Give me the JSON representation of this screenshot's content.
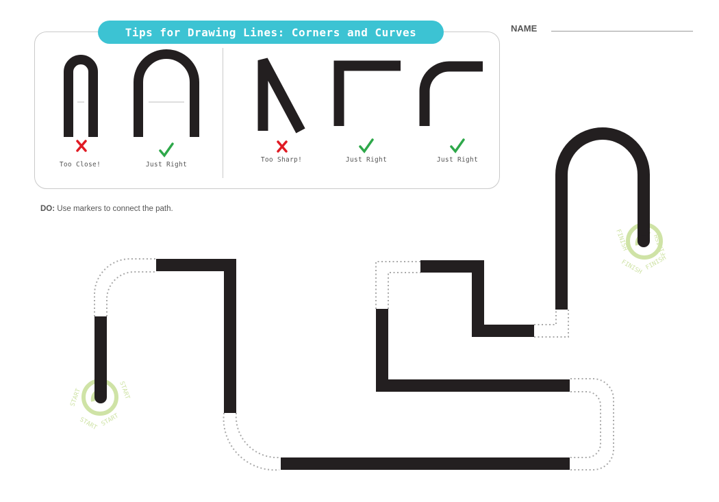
{
  "tips": {
    "title": "Tips for Drawing Lines: Corners and Curves",
    "examples": [
      {
        "caption": "Too Close!",
        "mark": "x",
        "mark_color": "#e01b24"
      },
      {
        "caption": "Just Right",
        "mark": "check",
        "mark_color": "#2ea84a"
      },
      {
        "caption": "Too Sharp!",
        "mark": "x",
        "mark_color": "#e01b24"
      },
      {
        "caption": "Just Right",
        "mark": "check",
        "mark_color": "#2ea84a"
      },
      {
        "caption": "Just Right",
        "mark": "check",
        "mark_color": "#2ea84a"
      }
    ]
  },
  "header": {
    "name_label": "NAME"
  },
  "instructions": {
    "prefix": "DO:",
    "text": "Use markers to connect the path."
  },
  "start_badge": {
    "label": "START",
    "color": "#cfe3a6"
  },
  "finish_badge": {
    "label": "FINISH",
    "color": "#cfe3a6"
  },
  "colors": {
    "accent": "#3cc3d3",
    "line": "#231f20",
    "dotted": "#a8a8a8"
  }
}
